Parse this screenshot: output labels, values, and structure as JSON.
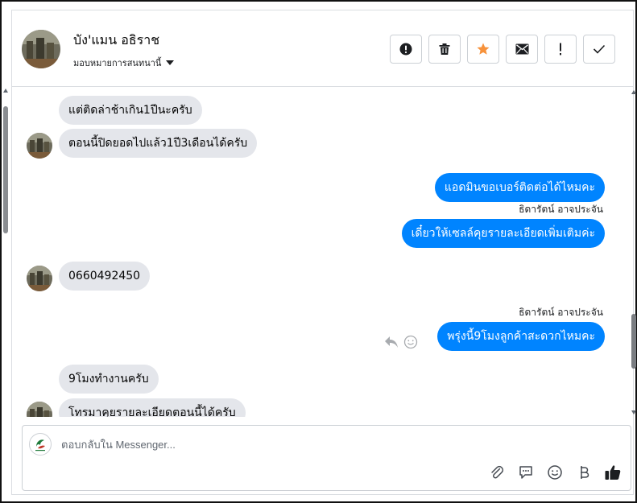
{
  "header": {
    "contact_name": "บัง'แมน อธิราช",
    "assign_label": "มอบหมายการสนทนานี้",
    "actions": [
      {
        "name": "spam-button",
        "icon": "alert-circle-icon"
      },
      {
        "name": "delete-button",
        "icon": "trash-icon"
      },
      {
        "name": "star-button",
        "icon": "star-icon"
      },
      {
        "name": "mark-unread-button",
        "icon": "envelope-icon"
      },
      {
        "name": "mark-important-button",
        "icon": "exclamation-icon"
      },
      {
        "name": "mark-done-button",
        "icon": "check-icon"
      }
    ]
  },
  "messages": [
    {
      "dir": "in",
      "text": "แต่ติดล่าช้าเกิน1ปีนะครับ"
    },
    {
      "dir": "in",
      "text": "ตอนนี้ปิดยอดไปแล้ว1ปี3เดือนได้ครับ"
    },
    {
      "dir": "out",
      "text": "แอดมินขอเบอร์ติดต่อได้ไหมคะ"
    },
    {
      "dir": "out",
      "sender": "ธิดารัตน์ อาจประจัน",
      "text": "เดี๋ยวให้เซลล์คุยรายละเอียดเพิ่มเติมค่ะ"
    },
    {
      "dir": "in",
      "text": "0660492450"
    },
    {
      "dir": "out",
      "sender": "ธิดารัตน์ อาจประจัน",
      "text": "พรุ่งนี้9โมงลูกค้าสะดวกไหมคะ"
    },
    {
      "dir": "in",
      "text": "9โมงทำงานครับ"
    },
    {
      "dir": "in",
      "text": "โทรมาคุยรายละเอียดตอนนี้ได้ครับ"
    }
  ],
  "composer": {
    "placeholder": "ตอบกลับใน Messenger..."
  },
  "colors": {
    "outgoing_bubble": "#0084ff",
    "incoming_bubble": "#e4e6eb",
    "star": "#f7923b"
  }
}
